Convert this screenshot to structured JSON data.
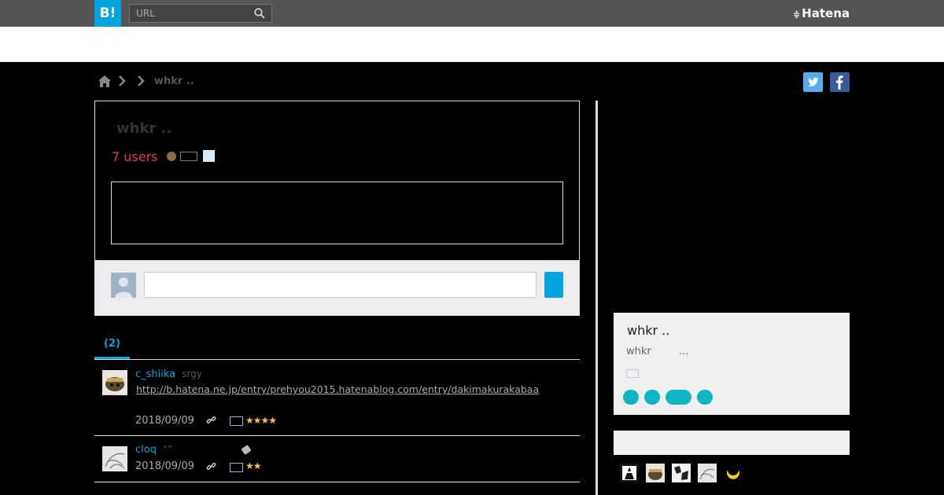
{
  "header": {
    "logo_text": "B!",
    "search_placeholder": "URL",
    "brand_mark": "≑",
    "brand_name": "Hatena"
  },
  "breadcrumb": {
    "current": "whkr .."
  },
  "entry": {
    "title": "whkr ..",
    "users": "7 users"
  },
  "tabs": {
    "active_label": "(2)"
  },
  "bookmarks": [
    {
      "user": "c_shiika",
      "tag": "srgy",
      "link": "http://b.hatena.ne.jp/entry/prehyou2015.hatenablog.com/entry/dakimakurakabaa",
      "date": "2018/09/09",
      "stars": "★★★★"
    },
    {
      "user": "cloq",
      "tag": "“”",
      "date": "2018/09/09",
      "stars": "★★"
    }
  ],
  "site": {
    "title": "whkr ..",
    "desc": "whkr",
    "ellipsis": "..."
  },
  "colors": {
    "accent": "#00a4de",
    "users": "#e23a4b",
    "star": "#f5c04a",
    "pill": "#10b5c2"
  }
}
